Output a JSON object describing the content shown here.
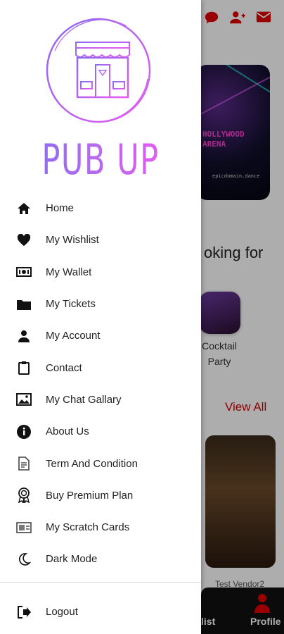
{
  "brand": {
    "name": "PUB UP"
  },
  "menu": [
    {
      "label": "Home",
      "icon": "home-icon"
    },
    {
      "label": "My Wishlist",
      "icon": "heart-icon"
    },
    {
      "label": "My Wallet",
      "icon": "wallet-icon"
    },
    {
      "label": "My Tickets",
      "icon": "folder-icon"
    },
    {
      "label": "My Account",
      "icon": "person-icon"
    },
    {
      "label": "Contact",
      "icon": "clipboard-icon"
    },
    {
      "label": "My Chat Gallary",
      "icon": "image-icon"
    },
    {
      "label": "About Us",
      "icon": "info-icon"
    },
    {
      "label": "Term And Condition",
      "icon": "document-icon"
    },
    {
      "label": "Buy Premium Plan",
      "icon": "award-icon"
    },
    {
      "label": "My Scratch Cards",
      "icon": "scratch-card-icon"
    },
    {
      "label": "Dark Mode",
      "icon": "moon-icon"
    }
  ],
  "logout": {
    "label": "Logout",
    "icon": "logout-icon"
  },
  "background": {
    "top_icons": [
      "chat-icon",
      "add-user-icon",
      "mail-icon"
    ],
    "event_card": {
      "title": "HOLLYWOOD\nARENA",
      "site": "epicdomain.dance"
    },
    "section_heading": "oking for",
    "category": {
      "label": "Cocktail Party"
    },
    "view_all": "View All",
    "vendor_label": "Test Vendor2",
    "bottom_nav": {
      "wishlist_label": "list",
      "profile_label": "Profile"
    }
  },
  "colors": {
    "accent": "#e00000",
    "brand_start": "#8a6bf0",
    "brand_end": "#e85af0",
    "overlay": "rgba(0,0,0,0.32)"
  }
}
